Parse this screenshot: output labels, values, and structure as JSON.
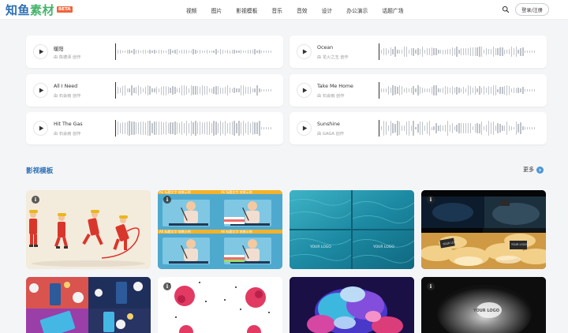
{
  "header": {
    "logo_part1": "知鱼",
    "logo_part2": "素材",
    "logo_badge": "BETA",
    "nav": [
      "视频",
      "图片",
      "影视模板",
      "音乐",
      "音效",
      "设计",
      "办公演示",
      "话题广场"
    ],
    "login_label": "登录/注册",
    "search_icon": "search-icon"
  },
  "audio": [
    {
      "title": "暖阳",
      "author": "由 陈德泽 创作"
    },
    {
      "title": "Ocean",
      "author": "由 花火之玉 创作"
    },
    {
      "title": "All I Need",
      "author": "由 石会雨 创作"
    },
    {
      "title": "Take Me Home",
      "author": "由 石会雨 创作"
    },
    {
      "title": "Hit The Gas",
      "author": "由 石会雨 创作"
    },
    {
      "title": "Sunshine",
      "author": "由 GAGA 创作"
    }
  ],
  "section": {
    "title": "影视模板",
    "more_label": "更多"
  },
  "templates": {
    "info_glyph": "i",
    "overlay_tag": "AE 标题文字 效果示例",
    "card3_tag": "YOUR LOGO",
    "card4_tag": "YOUR LOGO",
    "card8_tag": "YOUR LOGO"
  },
  "colors": {
    "brand_blue": "#2b6fb6",
    "brand_green": "#45b36b",
    "beta": "#f0643c",
    "more_icon": "#4a97d6"
  }
}
